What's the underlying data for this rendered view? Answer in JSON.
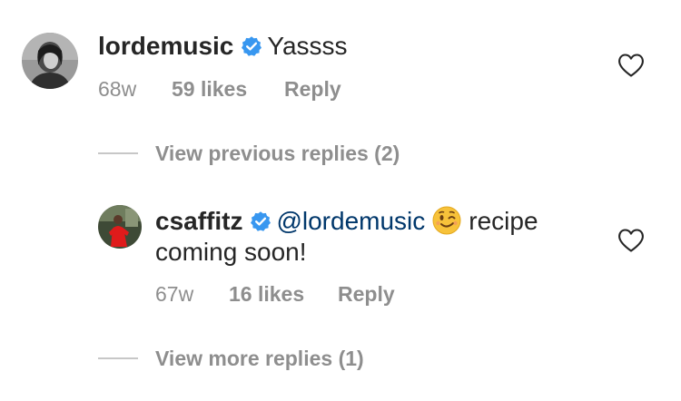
{
  "comments": [
    {
      "username": "lordemusic",
      "verified": true,
      "text": "Yassss",
      "age": "68w",
      "likes": "59 likes",
      "reply_label": "Reply",
      "liked": false
    },
    {
      "username": "csaffitz",
      "verified": true,
      "mention": "@lordemusic",
      "emoji": "winking-face-emoji",
      "text_line1": "recipe",
      "text_line2": "coming soon!",
      "age": "67w",
      "likes": "16 likes",
      "reply_label": "Reply",
      "liked": false
    }
  ],
  "view_previous_replies": "View previous replies (2)",
  "view_more_replies": "View more replies (1)",
  "icons": {
    "verified": "verified-badge-icon",
    "heart": "heart-outline-icon"
  },
  "colors": {
    "primary_text": "#262626",
    "secondary_text": "#8e8e8e",
    "verified_blue": "#3897f0",
    "mention": "#00376b",
    "divider": "#c7c7c7"
  }
}
